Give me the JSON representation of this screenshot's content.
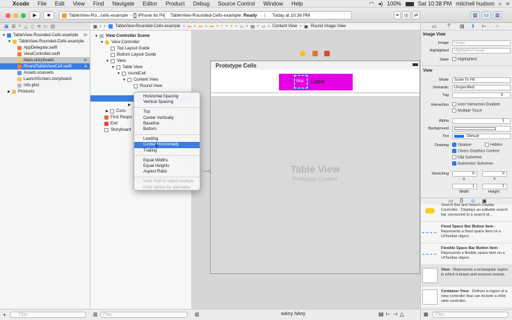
{
  "menubar": {
    "apple": "",
    "items": [
      "Xcode",
      "File",
      "Edit",
      "View",
      "Find",
      "Navigate",
      "Editor",
      "Product",
      "Debug",
      "Source Control",
      "Window",
      "Help"
    ],
    "battery": "100%",
    "clock": "Sat 10:38 PM",
    "user": "mitchell hudson"
  },
  "toolbar": {
    "scheme": "TableView-Ro...cells-example",
    "device": "iPhone 6s Plus",
    "status_project": "TableView-Rounded-Cells-example:",
    "status_state": "Ready",
    "status_time": "Today at 10:38 PM"
  },
  "navigator": {
    "project": "TableView-Rounded-Cells-example",
    "project_flag": "M",
    "group": "TableView-Rounded-Cells-example",
    "files": [
      {
        "name": "AppDelegate.swift",
        "flag": ""
      },
      {
        "name": "ViewController.swift",
        "flag": ""
      },
      {
        "name": "Main.storyboard",
        "flag": "M"
      },
      {
        "name": "RoundTableViewCell.swift",
        "flag": "A"
      },
      {
        "name": "Assets.xcassets",
        "flag": ""
      },
      {
        "name": "LaunchScreen.storyboard",
        "flag": ""
      },
      {
        "name": "Info.plist",
        "flag": ""
      }
    ],
    "products": "Products"
  },
  "jumpbar": {
    "crumbs": [
      "TableView-Rounded-Cells-example",
      "Content View",
      "Round Image View"
    ]
  },
  "outline": {
    "items": [
      {
        "label": "View Controller Scene",
        "indent": 0
      },
      {
        "label": "View Controller",
        "indent": 1
      },
      {
        "label": "Top Layout Guide",
        "indent": 2
      },
      {
        "label": "Bottom Layout Guide",
        "indent": 2
      },
      {
        "label": "View",
        "indent": 2
      },
      {
        "label": "Table View",
        "indent": 3
      },
      {
        "label": "roundCell",
        "indent": 4
      },
      {
        "label": "Content View",
        "indent": 5
      },
      {
        "label": "Round View",
        "indent": 6
      }
    ],
    "lower": [
      "Cons",
      "First Respo",
      "Exit",
      "Storyboard"
    ]
  },
  "canvas": {
    "prototype_header": "Prototype Cells",
    "cell_label": "Label",
    "image_text": "Ima",
    "tableview_title": "Table View",
    "tableview_sub": "Prototype Content",
    "size_w": "wAny",
    "size_h": "hAny"
  },
  "context_menu": {
    "group1": [
      "Horizontal Spacing",
      "Vertical Spacing"
    ],
    "group2": [
      "Top",
      "Center Vertically",
      "Baseline",
      "Bottom"
    ],
    "group3": [
      "Leading",
      "Center Horizontally",
      "Trailing"
    ],
    "highlighted": "Center Horizontally",
    "group4": [
      "Equal Widths",
      "Equal Heights",
      "Aspect Ratio"
    ],
    "hints": [
      "Hold Shift to select multiple",
      "Hold Option for alternates"
    ]
  },
  "inspector": {
    "section_image_view": "Image View",
    "image_label": "Image",
    "image_placeholder": "Image",
    "highlighted_label": "Highlighted",
    "highlighted_placeholder": "Highlighted Image",
    "state_label": "State",
    "state_value": "Highlighted",
    "section_view": "View",
    "mode_label": "Mode",
    "mode_value": "Scale To Fill",
    "semantic_label": "Semantic",
    "semantic_value": "Unspecified",
    "tag_label": "Tag",
    "tag_value": "0",
    "interaction_label": "Interaction",
    "user_interaction": "User Interaction Enabled",
    "multiple_touch": "Multiple Touch",
    "alpha_label": "Alpha",
    "alpha_value": "1",
    "background_label": "Background",
    "tint_label": "Tint",
    "tint_value": "Default",
    "drawing_label": "Drawing",
    "opaque": "Opaque",
    "hidden": "Hidden",
    "clears": "Clears Graphics Context",
    "clip": "Clip Subviews",
    "autoresize": "Autoresize Subviews",
    "stretching_label": "Stretching",
    "stretch_x": "0",
    "stretch_y": "0",
    "stretch_w": "1",
    "stretch_h": "1",
    "x_label": "X",
    "y_label": "Y",
    "width_label": "Width",
    "height_label": "Height"
  },
  "library": {
    "items": [
      {
        "title": "",
        "desc": "Search Bar and Search Display Controller - Displays an editable search bar connected to a search di..."
      },
      {
        "title": "Fixed Space Bar Button Item",
        "desc": " - Represents a fixed space item on a UIToolbar object."
      },
      {
        "title": "Flexible Space Bar Button Item",
        "desc": " - Represents a flexible space item on a UIToolbar object."
      },
      {
        "title": "View",
        "desc": " - Represents a rectangular region in which it draws and receives events."
      },
      {
        "title": "Container View",
        "desc": " - Defines a region of a view controller that can include a child view controller."
      }
    ]
  },
  "filters": {
    "placeholder": "Filter"
  },
  "colors": {
    "accent": "#3b7de0",
    "cell_magenta": "#e600e6"
  }
}
